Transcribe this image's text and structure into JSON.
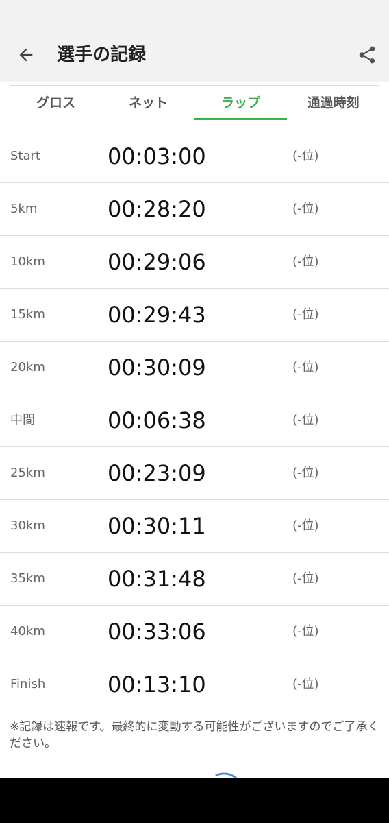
{
  "header": {
    "title": "選手の記録",
    "back_icon": "arrow-left-icon",
    "share_icon": "share-icon"
  },
  "tabs": [
    {
      "label": "グロス",
      "active": false
    },
    {
      "label": "ネット",
      "active": false
    },
    {
      "label": "ラップ",
      "active": true
    },
    {
      "label": "通過時刻",
      "active": false
    }
  ],
  "records": [
    {
      "point": "Start",
      "time": "00:03:00",
      "rank": "(-位)"
    },
    {
      "point": "5km",
      "time": "00:28:20",
      "rank": "(-位)"
    },
    {
      "point": "10km",
      "time": "00:29:06",
      "rank": "(-位)"
    },
    {
      "point": "15km",
      "time": "00:29:43",
      "rank": "(-位)"
    },
    {
      "point": "20km",
      "time": "00:30:09",
      "rank": "(-位)"
    },
    {
      "point": "中間",
      "time": "00:06:38",
      "rank": "(-位)"
    },
    {
      "point": "25km",
      "time": "00:23:09",
      "rank": "(-位)"
    },
    {
      "point": "30km",
      "time": "00:30:11",
      "rank": "(-位)"
    },
    {
      "point": "35km",
      "time": "00:31:48",
      "rank": "(-位)"
    },
    {
      "point": "40km",
      "time": "00:33:06",
      "rank": "(-位)"
    },
    {
      "point": "Finish",
      "time": "00:13:10",
      "rank": "(-位)"
    }
  ],
  "note": "※記録は速報です。最終的に変動する可能性がございますのでご了承ください。",
  "colors": {
    "accent": "#3cae4a",
    "app_bar": "#f2f2f2",
    "divider": "#dcdcdc"
  }
}
